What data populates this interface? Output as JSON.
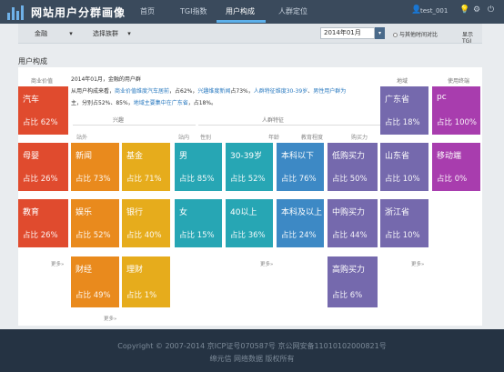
{
  "app": {
    "title": "网站用户分群画像"
  },
  "nav": [
    {
      "label": "首页"
    },
    {
      "label": "TGI指数"
    },
    {
      "label": "用户构成"
    },
    {
      "label": "人群定位"
    }
  ],
  "user": {
    "name": "test_001"
  },
  "filters": {
    "industry": "金融",
    "group": "选择族群",
    "date": "2014年01月",
    "compare": "与其他时间对比",
    "tgi": "显示TGI"
  },
  "section_title": "用户构成",
  "summary": {
    "p1": "2014年01月，金融的用户群",
    "p2a": "从用户构成来看，",
    "p2b": "商业价值维度汽车居前",
    "p2c": "，占62%，",
    "p2d": "兴趣维度新闻",
    "p2e": "占73%，",
    "p2f": "人群特征维度30-39岁",
    "p2g": "、",
    "p2h": "男性用户群为",
    "p3a": "主，分别占52%、85%，",
    "p3b": "地域主要集中在广东省",
    "p3c": "，占18%。"
  },
  "headers": {
    "commercial": "商业价值",
    "interest": "兴趣",
    "station_out": "站外",
    "station_in": "站内",
    "crowd": "人群特征",
    "gender": "性别",
    "age": "年龄",
    "education": "教育程度",
    "purchase": "购买力",
    "region": "地域",
    "terminal": "使用终端"
  },
  "tiles": {
    "car": {
      "label": "汽车",
      "pct": "占比 62%"
    },
    "baby": {
      "label": "母婴",
      "pct": "占比 26%"
    },
    "edu": {
      "label": "教育",
      "pct": "占比 26%"
    },
    "news": {
      "label": "新闻",
      "pct": "占比 73%"
    },
    "ent": {
      "label": "娱乐",
      "pct": "占比 52%"
    },
    "fin": {
      "label": "财经",
      "pct": "占比 49%"
    },
    "fund": {
      "label": "基金",
      "pct": "占比 71%"
    },
    "bank": {
      "label": "银行",
      "pct": "占比 40%"
    },
    "wm": {
      "label": "理财",
      "pct": "占比 1%"
    },
    "male": {
      "label": "男",
      "pct": "占比 85%"
    },
    "female": {
      "label": "女",
      "pct": "占比 15%"
    },
    "age3039": {
      "label": "30-39岁",
      "pct": "占比 52%"
    },
    "age40": {
      "label": "40以上",
      "pct": "占比 36%"
    },
    "bach_below": {
      "label": "本科以下",
      "pct": "占比 76%"
    },
    "bach_above": {
      "label": "本科及以上",
      "pct": "占比 24%"
    },
    "low": {
      "label": "低购买力",
      "pct": "占比 50%"
    },
    "mid": {
      "label": "中购买力",
      "pct": "占比 44%"
    },
    "high": {
      "label": "高购买力",
      "pct": "占比 6%"
    },
    "gd": {
      "label": "广东省",
      "pct": "占比 18%"
    },
    "sd": {
      "label": "山东省",
      "pct": "占比 10%"
    },
    "zj": {
      "label": "浙江省",
      "pct": "占比 10%"
    },
    "pc": {
      "label": "pc",
      "pct": "占比 100%"
    },
    "mobile": {
      "label": "移动端",
      "pct": "占比 0%"
    }
  },
  "more": "更多»",
  "footer": {
    "line1": "Copyright © 2007-2014 京ICP证号070587号 京公网安备110101020008​21号",
    "line2": "绵元信 网络数据 版权所有"
  },
  "colors": {
    "red": "#e04b2e",
    "orange": "#e98a1d",
    "yellow": "#e6ac1c",
    "teal": "#27a6b4",
    "blue": "#3d89c5",
    "purple": "#7569ad",
    "magenta": "#a83dae",
    "topbar": "#3a4a5c",
    "footer": "#253343"
  }
}
